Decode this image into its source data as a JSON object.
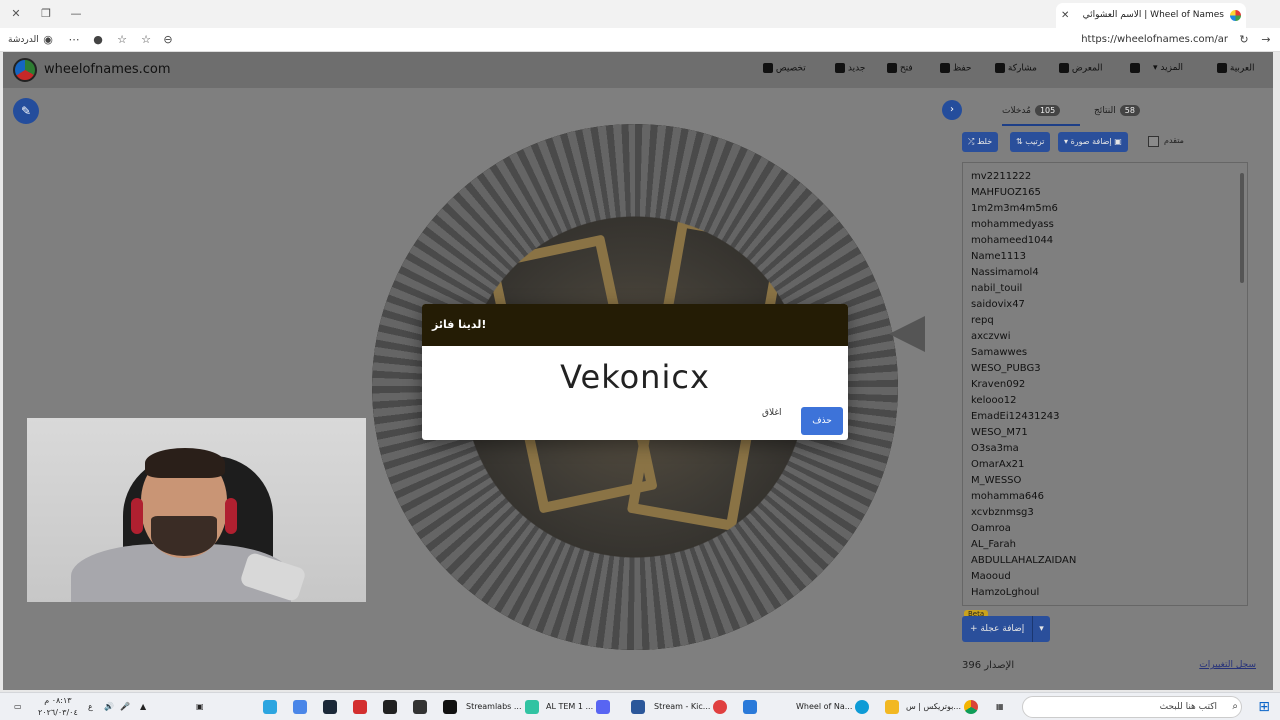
{
  "browser": {
    "tab_title": "الاسم العشوائي | Wheel of Names",
    "url": "https://wheelofnames.com/ar",
    "vault_label": "الدردشة"
  },
  "app": {
    "brand": "wheelofnames.com",
    "nav": {
      "customize": "تخصيص",
      "new": "جديد",
      "open": "فتح",
      "save": "حفظ",
      "share": "مشاركة",
      "gallery": "المعرض",
      "more": "المزيد",
      "language": "العربية"
    }
  },
  "panel": {
    "tab_entries_label": "مُدخلات",
    "tab_entries_count": "105",
    "tab_results_label": "النتائج",
    "tab_results_count": "58",
    "shuffle": "خلط",
    "sort": "ترتيب",
    "add_image": "إضافة صورة",
    "advanced": "متقدم",
    "entries": [
      "mv2211222",
      "MAHFUOZ165",
      "1m2m3m4m5m6",
      "mohammedyass",
      "mohameed1044",
      "Name1113",
      "Nassimamol4",
      "nabil_touil",
      "saidovix47",
      "repq",
      "axczvwi",
      "Samawwes",
      "WESO_PUBG3",
      "Kraven092",
      "kelooo12",
      "EmadEi12431243",
      "WESO_M71",
      "O3sa3ma",
      "OmarAx21",
      "M_WESSO",
      "mohamma646",
      "xcvbznmsg3",
      "Oamroa",
      "AL_Farah",
      "ABDULLAHALZAIDAN",
      "Maooud",
      "HamzoLghoul"
    ],
    "add_wheel": "إضافة عجلة",
    "beta": "Beta",
    "version_label": "الإصدار",
    "version_number": "396",
    "changelog": "سجل التغييرات"
  },
  "modal": {
    "title": "لدينا فائز!",
    "winner": "Vekonicx",
    "close": "اغلاق",
    "remove": "حذف"
  },
  "taskbar": {
    "search_placeholder": "اكتب هنا للبحث",
    "items": [
      "بوتريكس | س...",
      "Wheel of Na...",
      "Stream - Kic...",
      "AL TEM 1 ...",
      "Streamlabs ..."
    ],
    "time": "٠٨:١٣ م",
    "date": "٢٠٢٦/٠٣/٠٤"
  },
  "colors": {
    "accent": "#2a4f9b",
    "modal_header": "#241c05",
    "remove_button": "#3d73d9"
  }
}
